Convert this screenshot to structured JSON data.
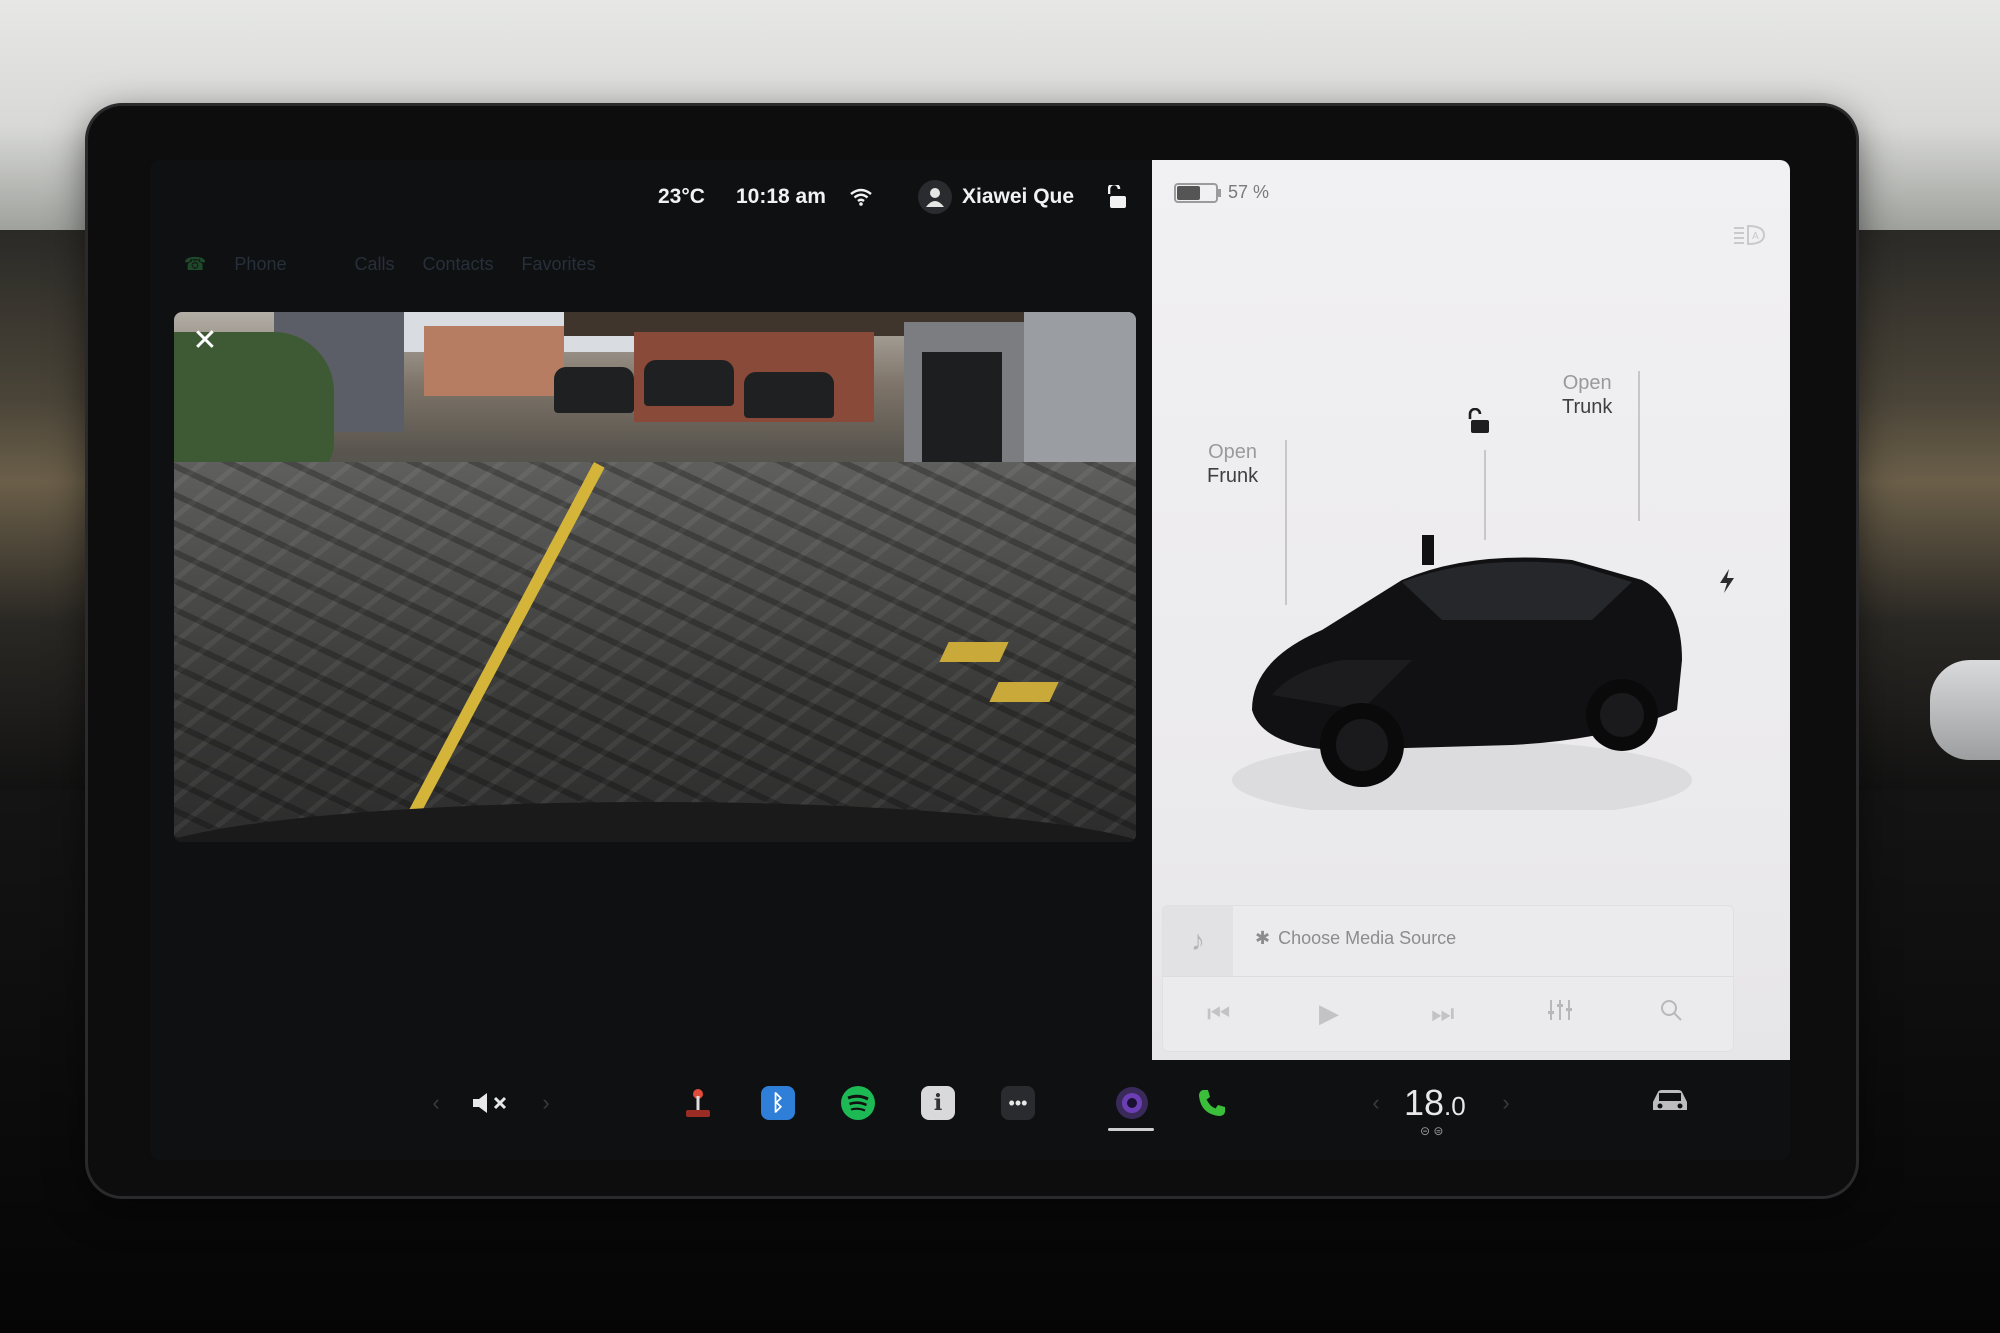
{
  "status_bar": {
    "temperature": "23°C",
    "time": "10:18 am",
    "user_name": "Xiawei Que",
    "battery_percent": "57 %",
    "battery_level": 0.57
  },
  "phone_tabs": [
    "Phone",
    "Calls",
    "Contacts",
    "Favorites"
  ],
  "camera": {
    "close_label": "✕"
  },
  "car_panel": {
    "frunk": {
      "line1": "Open",
      "line2": "Frunk"
    },
    "trunk": {
      "line1": "Open",
      "line2": "Trunk"
    }
  },
  "media": {
    "source_label": "Choose Media Source",
    "bluetooth_glyph": "✱"
  },
  "dock": {
    "volume_glyph": "🔇︎ ×",
    "climate_temp": "18",
    "climate_decimal": ".0",
    "apps": [
      "joystick-icon",
      "bluetooth-icon",
      "spotify-icon",
      "manual-icon",
      "more-icon",
      "camera-icon",
      "phone-icon"
    ]
  },
  "colors": {
    "spotify": "#1db954",
    "bluetooth": "#2f7fd9",
    "phone_green": "#3bbf3b",
    "camera_purple": "#6b3fb3",
    "panel_bg": "#efeef0"
  }
}
